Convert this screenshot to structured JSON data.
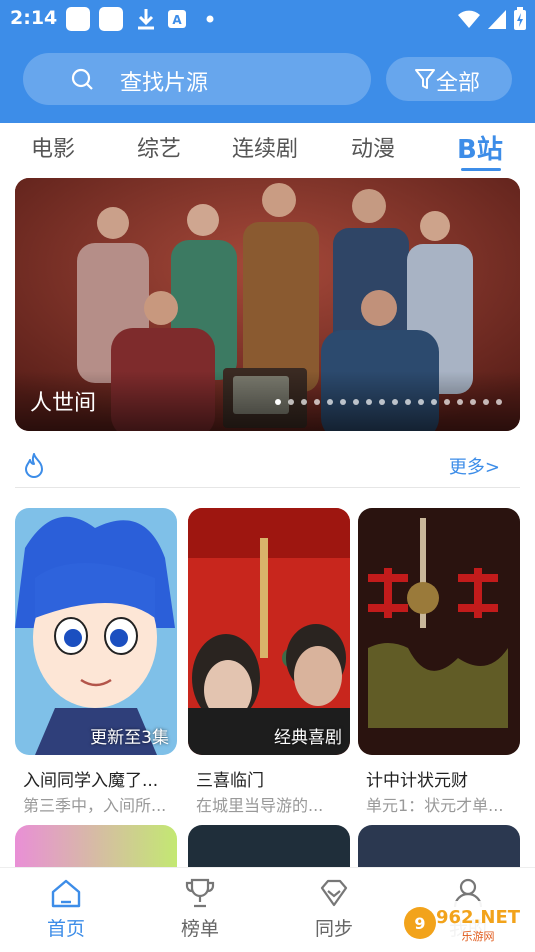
{
  "status_bar": {
    "time": "2:14"
  },
  "search": {
    "placeholder": "查找片源",
    "filter_label": "全部"
  },
  "tabs": [
    {
      "label": "电影"
    },
    {
      "label": "综艺"
    },
    {
      "label": "连续剧"
    },
    {
      "label": "动漫"
    },
    {
      "label": "B站",
      "active": true
    }
  ],
  "banner": {
    "title": "人世间",
    "dot_count": 18,
    "active_dot": 0
  },
  "section": {
    "more_label": "更多>"
  },
  "cards": [
    {
      "title": "入间同学入魔了...",
      "subtitle": "第三季中，入间所...",
      "badge": "更新至3集"
    },
    {
      "title": "三喜临门",
      "subtitle": "在城里当导游的...",
      "badge": "经典喜剧"
    },
    {
      "title": "计中计状元财",
      "subtitle": "单元1：状元才单...",
      "badge": ""
    }
  ],
  "bottom_nav": [
    {
      "label": "首页",
      "icon": "home-icon",
      "active": true
    },
    {
      "label": "榜单",
      "icon": "trophy-icon"
    },
    {
      "label": "同步",
      "icon": "diamond-icon"
    },
    {
      "label": "我的",
      "icon": "user-icon"
    }
  ],
  "watermark": {
    "text": "962.NET",
    "subtext": "乐游网"
  },
  "colors": {
    "accent": "#3d8de8",
    "header": "#3d8de8"
  }
}
